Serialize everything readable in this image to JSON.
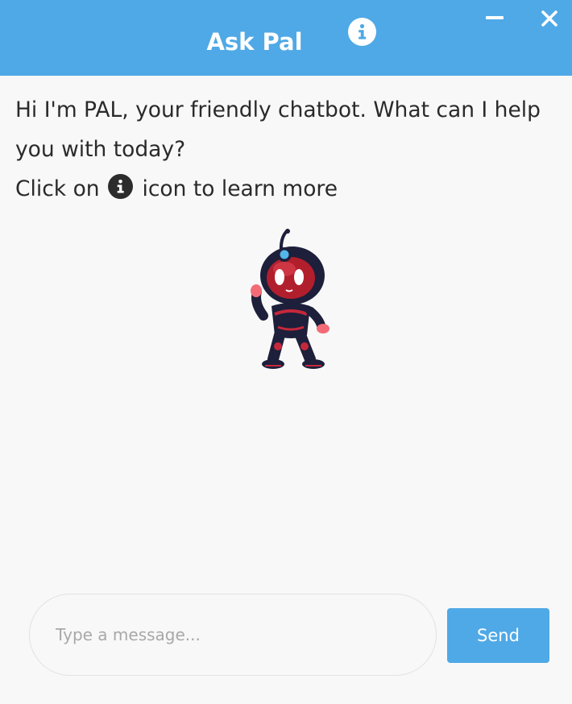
{
  "header": {
    "title": "Ask Pal",
    "info_icon": "info-circle-icon",
    "minimize_icon": "minimize-icon",
    "close_icon": "close-icon"
  },
  "chat": {
    "welcome_line1": "Hi I'm PAL, your friendly chatbot. What can I help you with today?",
    "welcome_line2_before": "Click on",
    "welcome_line2_after": "icon to learn more",
    "inline_icon": "info-circle-icon",
    "mascot": "robot-mascot"
  },
  "composer": {
    "placeholder": "Type a message...",
    "value": "",
    "send_label": "Send"
  },
  "colors": {
    "accent": "#4fa9e6",
    "background": "#f8f8f8",
    "text": "#2a2a2a"
  }
}
